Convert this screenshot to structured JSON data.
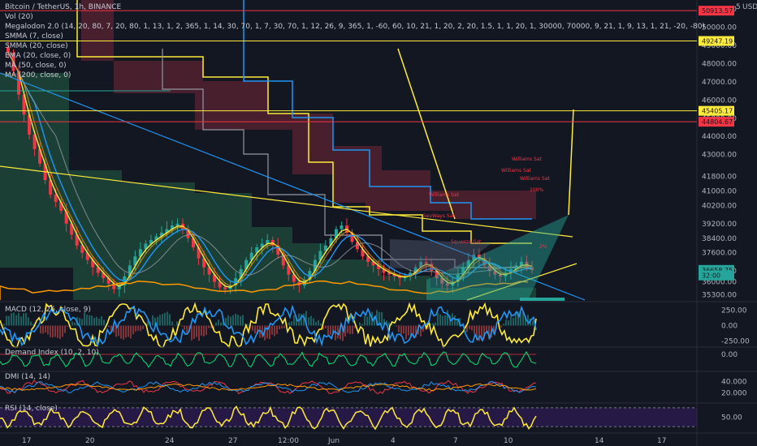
{
  "header": {
    "symbol": "Bitcoin / TetherUS, 1h, BINANCE",
    "currency": "USDT"
  },
  "legend_lines": [
    "Vol (20)",
    "Megalodon 2.0 (14, 20, 80, 7, 20, 80, 1, 13, 1, 2, 365, 1, 14, 30, 70, 1, 7, 30, 70, 1, 12, 26, 9, 365, 1, -60, 60, 10, 21, 1, 20, 2, 20, 1.5, 1, 1, 20, 1, 30000, 70000, 9, 21, 1, 9, 13, 1, 21, -20, -80)",
    "SMMA (7, close)",
    "SMMA (20, close)",
    "EMA (20, close, 0)",
    "MA (50, close, 0)",
    "MA (200, close, 0)"
  ],
  "colors": {
    "background": "#131722",
    "yellow": "#ffeb3b",
    "blue": "#2196f3",
    "red": "#f23645",
    "green": "#4caf50",
    "orange": "#ff9800",
    "teal": "#26a69a",
    "gray": "#9598a1",
    "purple_band": "#2a1a4a"
  },
  "chart_data": [
    {
      "type": "line",
      "pane": "price",
      "y_ticks": [
        51000,
        50000,
        49000,
        48000,
        47000,
        46000,
        45000,
        44000,
        43000,
        41800,
        41000,
        40200,
        39200,
        38400,
        37600,
        36600,
        36000,
        35300
      ],
      "ylim": [
        35000,
        51500
      ],
      "series_close": [
        48600,
        47600,
        46300,
        45200,
        44100,
        43300,
        42500,
        41600,
        40800,
        40400,
        39900,
        39200,
        38600,
        38000,
        37600,
        37200,
        36800,
        36500,
        36200,
        35900,
        35600,
        35800,
        36300,
        36900,
        37400,
        37800,
        38100,
        38300,
        38500,
        38700,
        38900,
        39100,
        39200,
        38900,
        38400,
        37900,
        37300,
        36800,
        36400,
        36000,
        35700,
        35600,
        35800,
        36200,
        36700,
        37200,
        37600,
        37900,
        38100,
        38300,
        38000,
        37500,
        36900,
        36400,
        36000,
        35800,
        36100,
        36600,
        37200,
        37700,
        38000,
        38400,
        38900,
        39100,
        38700,
        38200,
        37800,
        37400,
        37100,
        36900,
        36700,
        36500,
        36400,
        36300,
        36200,
        36300,
        36500,
        36800,
        37100,
        37000,
        36600,
        36200,
        35900,
        35800,
        36000,
        36400,
        36800,
        37200,
        37500,
        37300,
        36900,
        36600,
        36400,
        36300,
        36500,
        36700,
        36900,
        37100,
        36800,
        36660
      ],
      "price_tags": [
        {
          "label": "50913.57",
          "value": 50913.57,
          "color": "#f23645"
        },
        {
          "label": "49247.19",
          "value": 49247.19,
          "color": "#ffeb3b"
        },
        {
          "label": "45405.17",
          "value": 45405.17,
          "color": "#ffeb3b"
        },
        {
          "label": "44804.67",
          "value": 44804.67,
          "color": "#f23645"
        },
        {
          "label": "36658.75",
          "value": 36658.75,
          "color": "#26a69a"
        },
        {
          "label": "32:00",
          "value": 36350,
          "color": "#26a69a"
        }
      ],
      "signal_labels": [
        "Williams Sat",
        "Williams Sat",
        "Williams Sat",
        "Williams Sat",
        "Squeeze Sat",
        "SevWays Sat",
        "100%",
        "2%"
      ]
    },
    {
      "type": "line",
      "pane": "macd",
      "title": "MACD (12, 26, close, 9)",
      "y_ticks": [
        250.0,
        0.0,
        -250.0
      ],
      "ylim": [
        -350,
        350
      ]
    },
    {
      "type": "line",
      "pane": "demand",
      "title": "Demand Index (10, 2, 10)",
      "y_ticks": [
        0.0
      ],
      "ylim": [
        -1,
        1
      ]
    },
    {
      "type": "line",
      "pane": "dmi",
      "title": "DMI (14, 14)",
      "y_ticks": [
        40.0,
        20.0
      ],
      "ylim": [
        5,
        55
      ]
    },
    {
      "type": "line",
      "pane": "rsi",
      "title": "RSI (14, close)",
      "y_ticks": [
        50.0
      ],
      "ylim": [
        20,
        80
      ]
    }
  ],
  "x_axis": {
    "ticks": [
      "17",
      "20",
      "24",
      "27",
      "12:00",
      "Jun",
      "4",
      "7",
      "10",
      "14",
      "17"
    ]
  },
  "currency_tick": "5"
}
